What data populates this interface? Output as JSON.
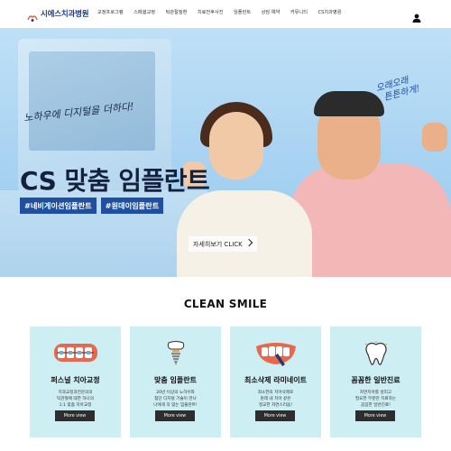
{
  "header": {
    "logo_text": "시에스치과병원",
    "nav": [
      "교정프로그램",
      "스페셜교정",
      "턱관절질환",
      "치료전후사진",
      "임플란트",
      "상담·예약",
      "커뮤니티",
      "CS치과병원"
    ]
  },
  "hero": {
    "script_text": "노하우에 디지털을 더하다!",
    "title": "CS 맞춤 임플란트",
    "tags": [
      "#네비게이션임플란트",
      "#원데이임플란트"
    ],
    "cta": "자세히보기 CLICK",
    "script_right": [
      "오래오래",
      "튼튼하게!"
    ],
    "slide_count": 3,
    "active_slide": 2
  },
  "section": {
    "title": "CLEAN SMILE"
  },
  "cards": [
    {
      "icon": "braces-icon",
      "title": "퍼스널 치아교정",
      "desc": [
        "치과교정과전문의의",
        "턱관절에 대한 하나의",
        "1:1 맞춤 치아교정"
      ],
      "button": "More view"
    },
    {
      "icon": "implant-icon",
      "title": "맞춤 임플란트",
      "desc": [
        "20년 이상의 노하우와",
        "첨단 디지털 기술이 만나",
        "나에게 꼭 맞는 임플란트!"
      ],
      "button": "More view"
    },
    {
      "icon": "laminate-icon",
      "title": "최소삭제 라미네이트",
      "desc": [
        "최소한의 치아삭제로",
        "원래 내 치아 같은",
        "정교한 자연스러움!"
      ],
      "button": "More view"
    },
    {
      "icon": "tooth-icon",
      "title": "꼼꼼한 일반진료",
      "desc": [
        "자연치아를 살리고",
        "필요한 부분만 치료하는",
        "꼼꼼한 일반진료!"
      ],
      "button": "More view"
    }
  ],
  "colors": {
    "brand": "#1f3a8a",
    "tag_bg": "#1f4fa0",
    "card_bg": "#cdeef3",
    "button_bg": "#2d2d2d"
  }
}
